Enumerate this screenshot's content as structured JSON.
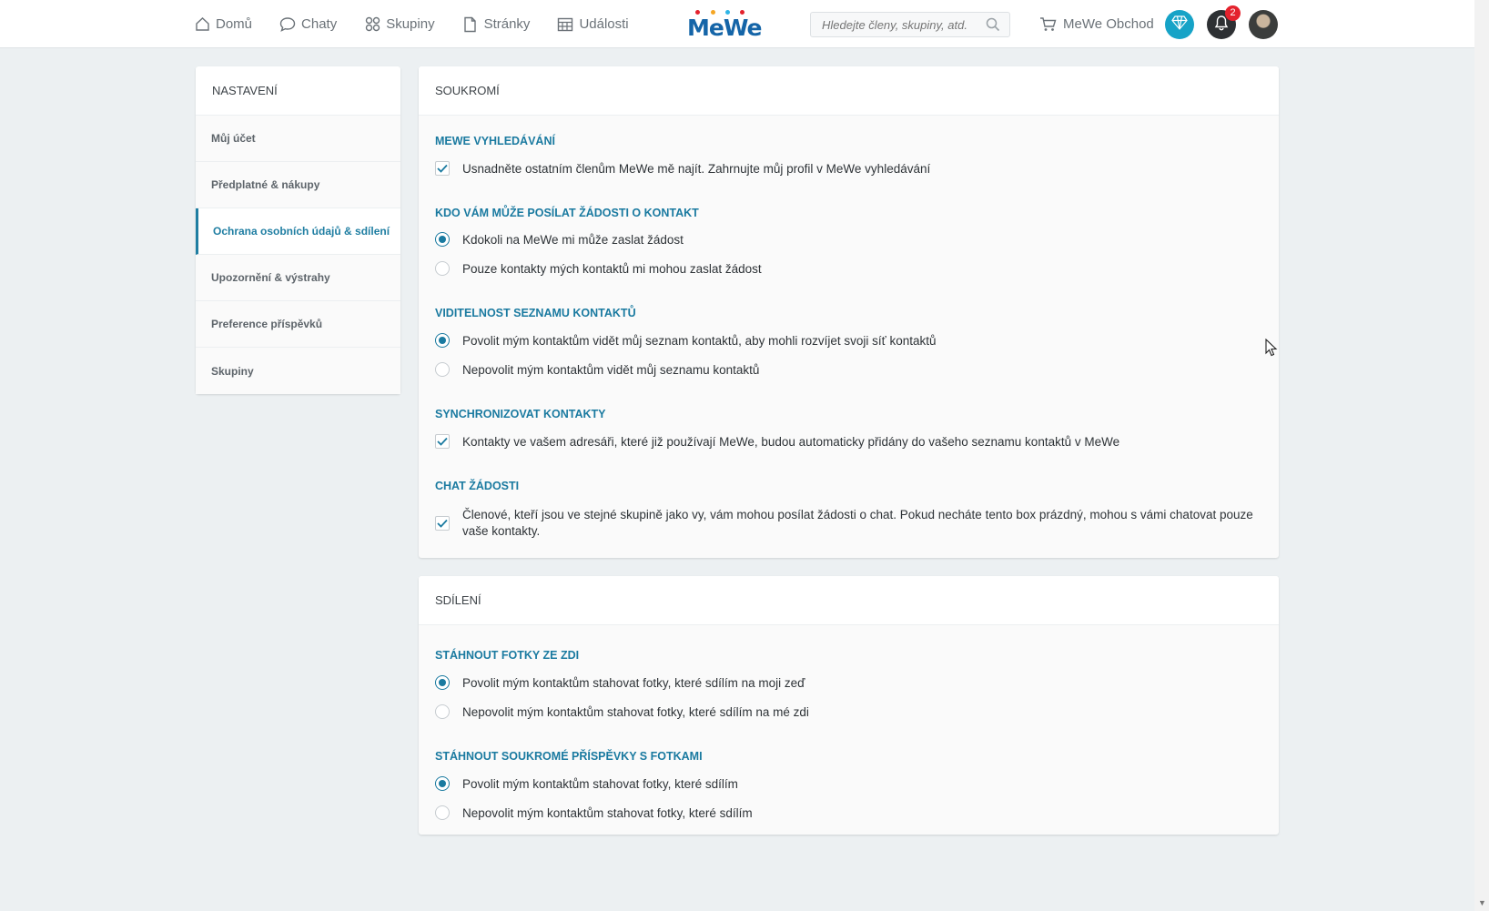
{
  "nav": {
    "items": [
      {
        "label": "Domů",
        "icon": "home-icon"
      },
      {
        "label": "Chaty",
        "icon": "chat-bubble-icon"
      },
      {
        "label": "Skupiny",
        "icon": "groups-icon"
      },
      {
        "label": "Stránky",
        "icon": "page-icon"
      },
      {
        "label": "Události",
        "icon": "calendar-icon"
      }
    ],
    "logo": "MeWe",
    "search_placeholder": "Hledejte členy, skupiny, atd.",
    "shop_label": "MeWe Obchod",
    "notification_count": "2"
  },
  "sidebar": {
    "title": "NASTAVENÍ",
    "items": [
      {
        "label": "Můj účet"
      },
      {
        "label": "Předplatné & nákupy"
      },
      {
        "label": "Ochrana osobních údajů & sdílení",
        "active": true
      },
      {
        "label": "Upozornění & výstrahy"
      },
      {
        "label": "Preference příspěvků"
      },
      {
        "label": "Skupiny"
      }
    ]
  },
  "privacy": {
    "title": "SOUKROMÍ",
    "search_title": "MEWE VYHLEDÁVÁNÍ",
    "search_opt": "Usnadněte ostatním členům MeWe mě najít. Zahrnujte můj profil v MeWe vyhledávání",
    "requests_title": "KDO VÁM MŮŽE POSÍLAT ŽÁDOSTI O KONTAKT",
    "requests_opt1": "Kdokoli na MeWe mi může zaslat žádost",
    "requests_opt2": "Pouze kontakty mých kontaktů mi mohou zaslat žádost",
    "visibility_title": "VIDITELNOST SEZNAMU KONTAKTŮ",
    "visibility_opt1": "Povolit mým kontaktům vidět můj seznam kontaktů, aby mohli rozvíjet svoji síť kontaktů",
    "visibility_opt2": "Nepovolit mým kontaktům vidět můj seznamu kontaktů",
    "sync_title": "SYNCHRONIZOVAT KONTAKTY",
    "sync_opt": "Kontakty ve vašem adresáři, které již používají MeWe, budou automaticky přidány do vašeho seznamu kontaktů v MeWe",
    "chat_title": "CHAT ŽÁDOSTI",
    "chat_opt": "Členové, kteří jsou ve stejné skupině jako vy, vám mohou posílat žádosti o chat. Pokud necháte tento box prázdný, mohou s vámi chatovat pouze vaše kontakty."
  },
  "sharing": {
    "title": "SDÍLENÍ",
    "wall_title": "STÁHNOUT FOTKY ZE ZDI",
    "wall_opt1": "Povolit mým kontaktům stahovat fotky, které sdílím na moji zeď",
    "wall_opt2": "Nepovolit mým kontaktům stahovat fotky, které sdílím na mé zdi",
    "private_title": "STÁHNOUT SOUKROMÉ PŘÍSPĚVKY S FOTKAMI",
    "private_opt1": "Povolit mým kontaktům stahovat fotky, které sdílím",
    "private_opt2": "Nepovolit mým kontaktům stahovat fotky, které sdílím"
  },
  "colors": {
    "accent": "#1a7aa0",
    "brand": "#1565a8",
    "background": "#ecf0f2"
  }
}
